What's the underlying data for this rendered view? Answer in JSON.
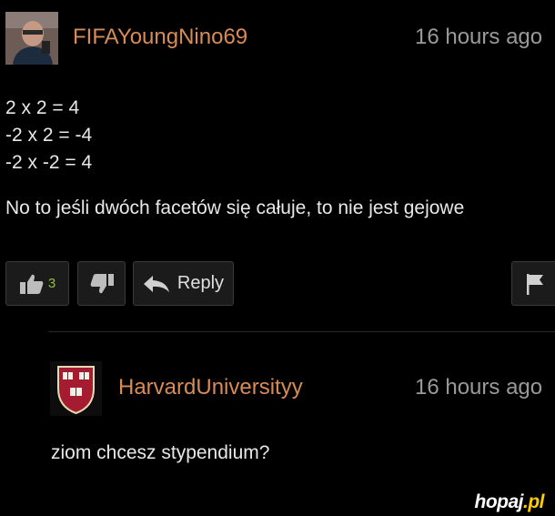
{
  "comment": {
    "username": "FIFAYoungNino69",
    "timestamp": "16 hours ago",
    "lines": [
      "2 x 2 = 4",
      "-2 x 2 = -4",
      "-2 x -2 = 4",
      "No to jeśli dwóch facetów się całuje, to nie jest gejowe"
    ],
    "likes": "3",
    "reply_label": "Reply"
  },
  "reply": {
    "username": "HarvardUniversityy",
    "timestamp": "16 hours ago",
    "text": "ziom chcesz stypendium?"
  },
  "watermark": {
    "brand": "hopaj",
    "tld": ".pl"
  },
  "colors": {
    "username": "#d98b56",
    "timestamp": "#9a9a9a",
    "likes": "#8ebf3d",
    "background": "#000000"
  },
  "icons": [
    "avatar",
    "thumbs-up-icon",
    "thumbs-down-icon",
    "reply-arrow-icon",
    "flag-icon",
    "harvard-shield-icon"
  ]
}
